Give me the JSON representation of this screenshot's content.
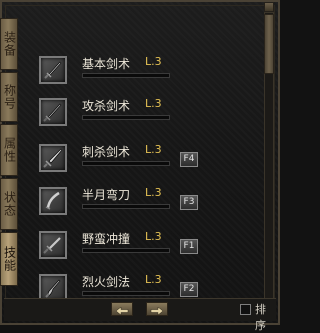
{
  "side_tabs": [
    {
      "label": "装备",
      "active": false
    },
    {
      "label": "称号",
      "active": false
    },
    {
      "label": "属性",
      "active": false
    },
    {
      "label": "状态",
      "active": false
    },
    {
      "label": "技能",
      "active": true
    }
  ],
  "skills": [
    {
      "name": "基本剑术",
      "level": "L.3",
      "key": "",
      "progress": 0.0
    },
    {
      "name": "攻杀剑术",
      "level": "L.3",
      "key": "",
      "progress": 0.0
    },
    {
      "name": "刺杀剑术",
      "level": "L.3",
      "key": "F4",
      "progress": 0.0
    },
    {
      "name": "半月弯刀",
      "level": "L.3",
      "key": "F3",
      "progress": 0.0
    },
    {
      "name": "野蛮冲撞",
      "level": "L.3",
      "key": "F1",
      "progress": 0.0
    },
    {
      "name": "烈火剑法",
      "level": "L.3",
      "key": "F2",
      "progress": 0.0
    }
  ],
  "bottom": {
    "sort_label": "排序",
    "prev_icon": "arrow-left-icon",
    "next_icon": "arrow-right-icon"
  }
}
